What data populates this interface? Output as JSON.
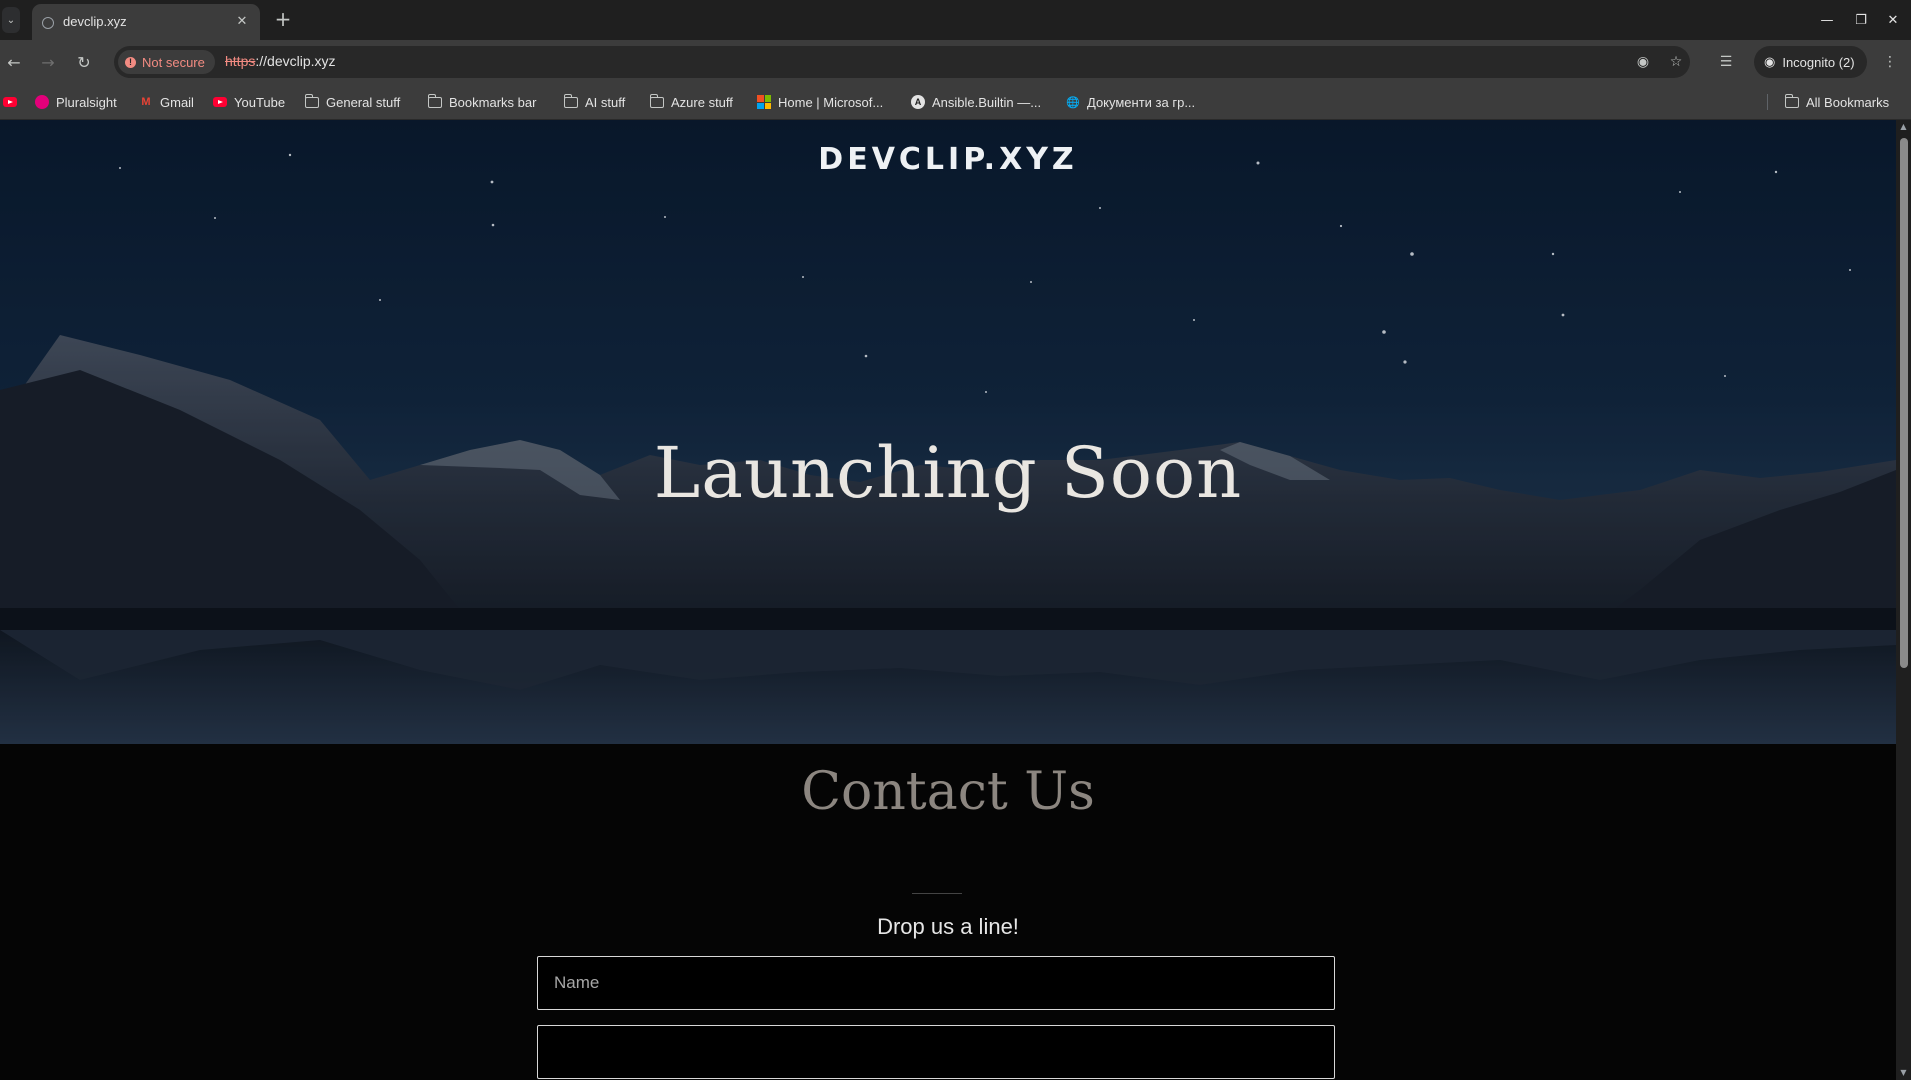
{
  "browser": {
    "tab_title": "devclip.xyz",
    "security_label": "Not secure",
    "url_scheme": "https",
    "url_rest": "://devclip.xyz",
    "incognito_label": "Incognito (2)",
    "bookmarks": [
      {
        "label": "Pluralsight",
        "icon": "pluralsight-icon"
      },
      {
        "label": "Gmail",
        "icon": "gmail-icon"
      },
      {
        "label": "YouTube",
        "icon": "youtube-icon"
      },
      {
        "label": "General stuff",
        "icon": "folder-icon"
      },
      {
        "label": "Bookmarks bar",
        "icon": "folder-icon"
      },
      {
        "label": "AI stuff",
        "icon": "folder-icon"
      },
      {
        "label": "Azure stuff",
        "icon": "folder-icon"
      },
      {
        "label": "Home | Microsof...",
        "icon": "microsoft-icon"
      },
      {
        "label": "Ansible.Builtin —...",
        "icon": "ansible-icon"
      },
      {
        "label": "Документи за гр...",
        "icon": "globe-icon"
      }
    ],
    "all_bookmarks_label": "All Bookmarks"
  },
  "page": {
    "brand": "DEVCLIP.XYZ",
    "hero_title": "Launching Soon",
    "contact": {
      "title": "Contact Us",
      "subtitle": "Drop us a line!",
      "name_placeholder": "Name",
      "email_placeholder": ""
    }
  },
  "colors": {
    "chrome_dark": "#1f1f1f",
    "toolbar": "#3c3c3c",
    "not_secure_red": "#f28b82",
    "page_bg": "#050505"
  }
}
